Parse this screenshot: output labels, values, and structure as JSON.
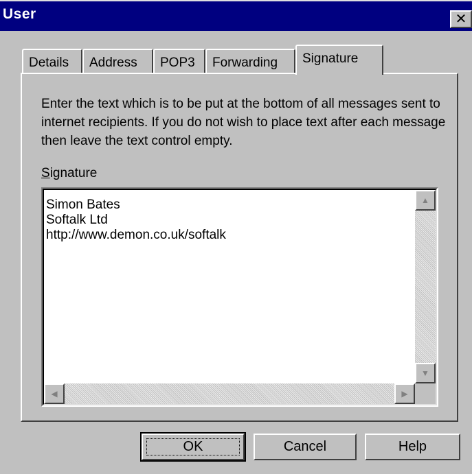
{
  "window": {
    "title": "User"
  },
  "tabs": [
    {
      "label": "Details",
      "active": false
    },
    {
      "label": "Address",
      "active": false
    },
    {
      "label": "POP3",
      "active": false
    },
    {
      "label": "Forwarding",
      "active": false
    },
    {
      "label": "Signature",
      "active": true
    }
  ],
  "signature_tab": {
    "description": "Enter the text which is to be put at the bottom of all messages sent to internet recipients. If you do not wish to place text after each message then leave the text control empty.",
    "label_mnemonic": "S",
    "label_rest": "ignature",
    "signature_text": "Simon Bates\nSoftalk Ltd\nhttp://www.demon.co.uk/softalk"
  },
  "buttons": {
    "ok": "OK",
    "cancel": "Cancel",
    "help": "Help"
  },
  "icons": {
    "close": "close-icon",
    "scroll_up": "arrow-up-icon",
    "scroll_down": "arrow-down-icon",
    "scroll_left": "arrow-left-icon",
    "scroll_right": "arrow-right-icon"
  }
}
